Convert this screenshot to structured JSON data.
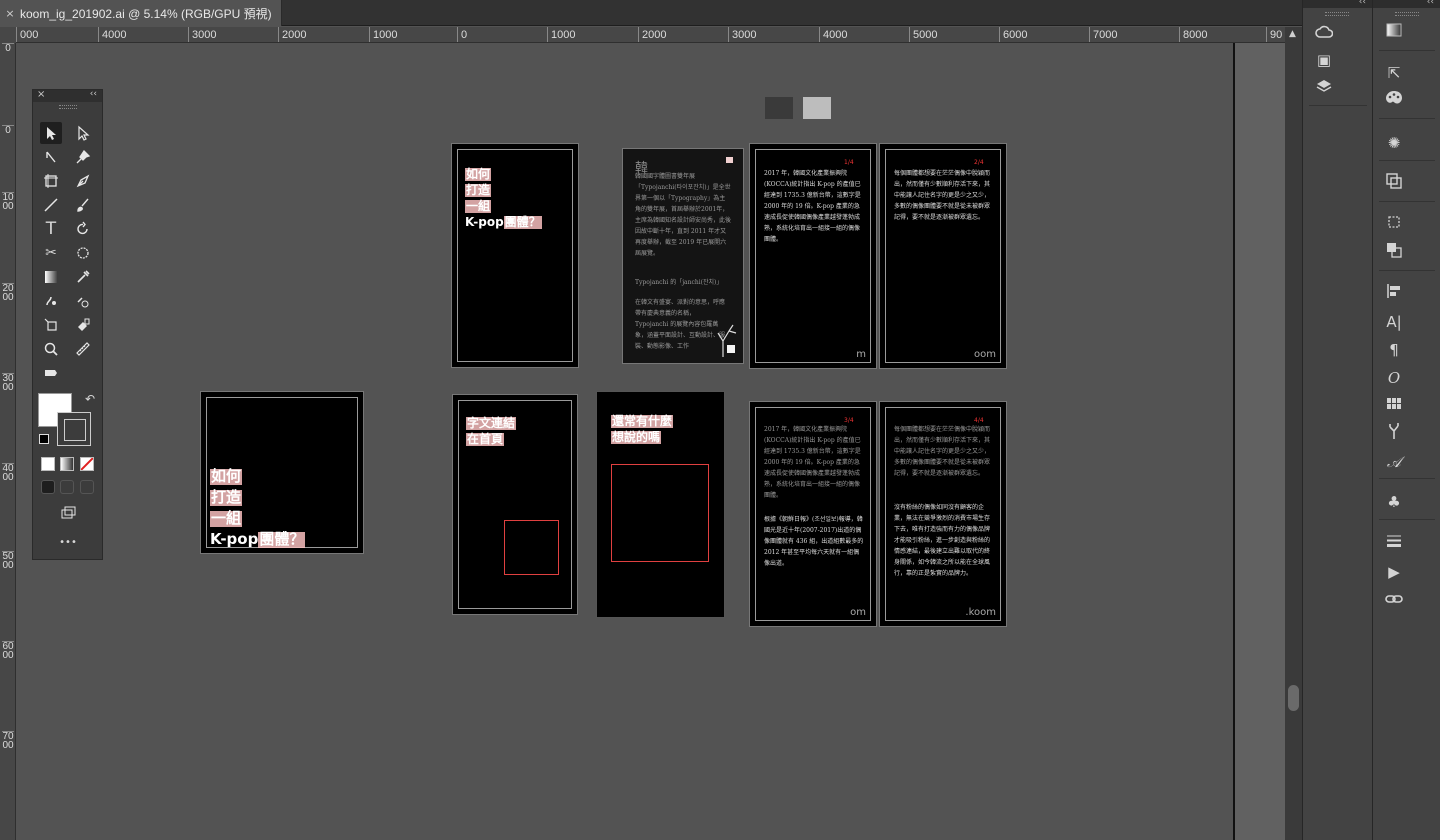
{
  "document": {
    "tab_title": "koom_ig_201902.ai @ 5.14% (RGB/GPU 預視)",
    "close_glyph": "×"
  },
  "ruler": {
    "horizontal": [
      "000",
      "4000",
      "3000",
      "2000",
      "1000",
      "0",
      "1000",
      "2000",
      "3000",
      "4000",
      "5000",
      "6000",
      "7000",
      "8000",
      "90"
    ],
    "vertical": [
      "0",
      "0",
      "1000",
      "2000",
      "3000",
      "4000",
      "5000",
      "6000",
      "7000"
    ]
  },
  "artboards": {
    "cover_small": {
      "lines": [
        "如何",
        "打造",
        "一組",
        "K-pop",
        "團體？"
      ]
    },
    "cover_large": {
      "lines": [
        "如何",
        "打造",
        "一組",
        "K-pop",
        "團體？"
      ]
    },
    "text_intro": {
      "heading": "韓",
      "body1": "韓國國字體圖書雙年展「Typojanchi(타이포잔치)」是全世界第一個以「Typography」為主角的雙年展，首屆舉辦於2001年，主席為韓國知名設計師安尚秀，此後因故中斷十年，直到 2011 年才又再度舉辦，截至 2019 年已展開六屆展覽。",
      "subhead": "Typojanchi 的「janchi(잔치)」",
      "body2": "在韓文有盛宴、派對的意思，呼應帶有慶典意義的名稱，Typojanchi 的展覽內容包羅萬象，涵蓋平面設計、互動設計、服裝、動態影像、工作"
    },
    "page1": {
      "num": "1/4",
      "text": "2017 年，韓國文化產業振興院(KOCCA)統計指出 K-pop 的產值已經達到 1735.3 億新台幣，這數字是 2000 年的 19 倍。K-pop 產業的急速成長促使韓國偶像產業越發蓬勃成熟，系統化培育出一組接一組的偶像團體。",
      "foot": "m"
    },
    "page2": {
      "num": "2/4",
      "text": "每個團體都想要在茫茫偶像中脫穎而出，然而僅有少數順利存活下來，其中能讓人記住名字的更是少之又少，多數的偶像團體要不就是從未被群眾記得，要不就是逐漸被群眾遺忘。",
      "foot": "oom"
    },
    "page3": {
      "num": "3/4",
      "text1": "2017 年，韓國文化產業振興院(KOCCA)統計指出 K-pop 的產值已經達到 1735.3 億新台幣，這數字是 2000 年的 19 倍。K-pop 產業的急速成長促使韓國偶像產業越發蓬勃成熟，系統化培育出一組接一組的偶像團體。",
      "text2": "根據《朝鮮日報》(조선일보)報導，韓國光是近十年(2007-2017)出道的偶像團體就有 436 組，出道組數最多的 2012 年甚至平均每六天就有一組偶像出道。",
      "foot": "om"
    },
    "page4": {
      "num": "4/4",
      "text1": "每個團體都想要在茫茫偶像中脫穎而出，然而僅有少數順利存活下來，其中能讓人記住名字的更是少之又少，多數的偶像團體要不就是從未被群眾記得，要不就是逐漸被群眾遺忘。",
      "text2": "沒有粉絲的偶像如同沒有顧客的企業，無法在競爭激烈的消費市場生存下去，唯有打造強而有力的偶像品牌才能吸引粉絲，進一步創造與粉絲的情感連結，最後建立出難以取代的終身關係，如今韓流之所以能在全球風行，靠的正是紮實的品牌力。",
      "foot": ".koom"
    },
    "ab_text_a": {
      "lines": [
        "字文連結",
        "在首頁"
      ]
    },
    "ab_text_b": {
      "lines": [
        "還常有什麼",
        "想說的嗎"
      ]
    }
  },
  "tools_panel": {
    "close_glyph": "×",
    "collapse_glyph": "‹‹",
    "more_glyph": "•••"
  },
  "right_panels": {
    "collapse_glyph": "‹‹"
  },
  "colors": {
    "app_bg": "#535353",
    "panel_bg": "#434343",
    "highlight": "#f8bebe",
    "accent_red": "#e04040"
  }
}
